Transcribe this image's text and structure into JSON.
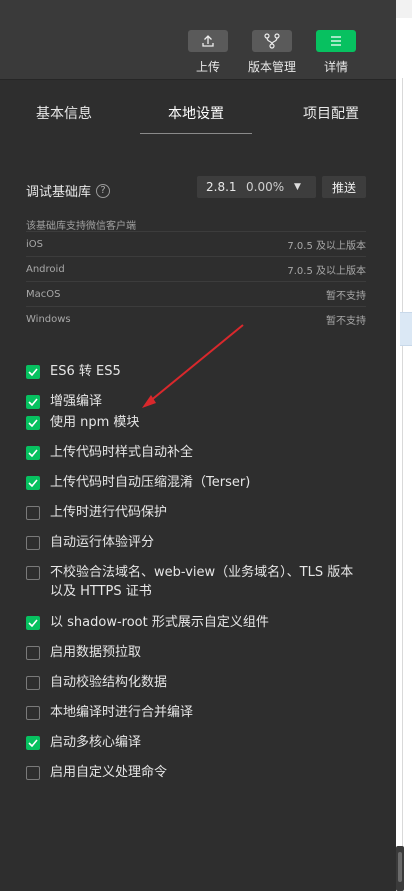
{
  "toolbar": {
    "upload_label": "上传",
    "version_label": "版本管理",
    "details_label": "详情"
  },
  "tabs": [
    {
      "label": "基本信息"
    },
    {
      "label": "本地设置"
    },
    {
      "label": "项目配置"
    }
  ],
  "base_library": {
    "label": "调试基础库",
    "help": "?",
    "version": "2.8.1",
    "percent": "0.00%",
    "push_label": "推送",
    "support_title": "该基础库支持微信客户端",
    "platforms": [
      {
        "name": "iOS",
        "value": "7.0.5 及以上版本"
      },
      {
        "name": "Android",
        "value": "7.0.5 及以上版本"
      },
      {
        "name": "MacOS",
        "value": "暂不支持"
      },
      {
        "name": "Windows",
        "value": "暂不支持"
      }
    ]
  },
  "options": [
    {
      "label": "ES6 转 ES5",
      "checked": true
    },
    {
      "label": "增强编译",
      "checked": true
    },
    {
      "label": "使用 npm 模块",
      "checked": true
    },
    {
      "label": "上传代码时样式自动补全",
      "checked": true
    },
    {
      "label": "上传代码时自动压缩混淆（Terser)",
      "checked": true
    },
    {
      "label": "上传时进行代码保护",
      "checked": false
    },
    {
      "label": "自动运行体验评分",
      "checked": false
    },
    {
      "label": "不校验合法域名、web-view（业务域名）、TLS 版本以及 HTTPS 证书",
      "checked": false
    },
    {
      "label": "以 shadow-root 形式展示自定义组件",
      "checked": true
    },
    {
      "label": "启用数据预拉取",
      "checked": false
    },
    {
      "label": "自动校验结构化数据",
      "checked": false
    },
    {
      "label": "本地编译时进行合并编译",
      "checked": false
    },
    {
      "label": "启动多核心编译",
      "checked": true
    },
    {
      "label": "启用自定义处理命令",
      "checked": false
    }
  ],
  "colors": {
    "accent": "#07c160",
    "panel_bg": "#2e2e2e",
    "toolbar_bg": "#3a3a3a",
    "annotation_arrow": "#d9282c"
  }
}
